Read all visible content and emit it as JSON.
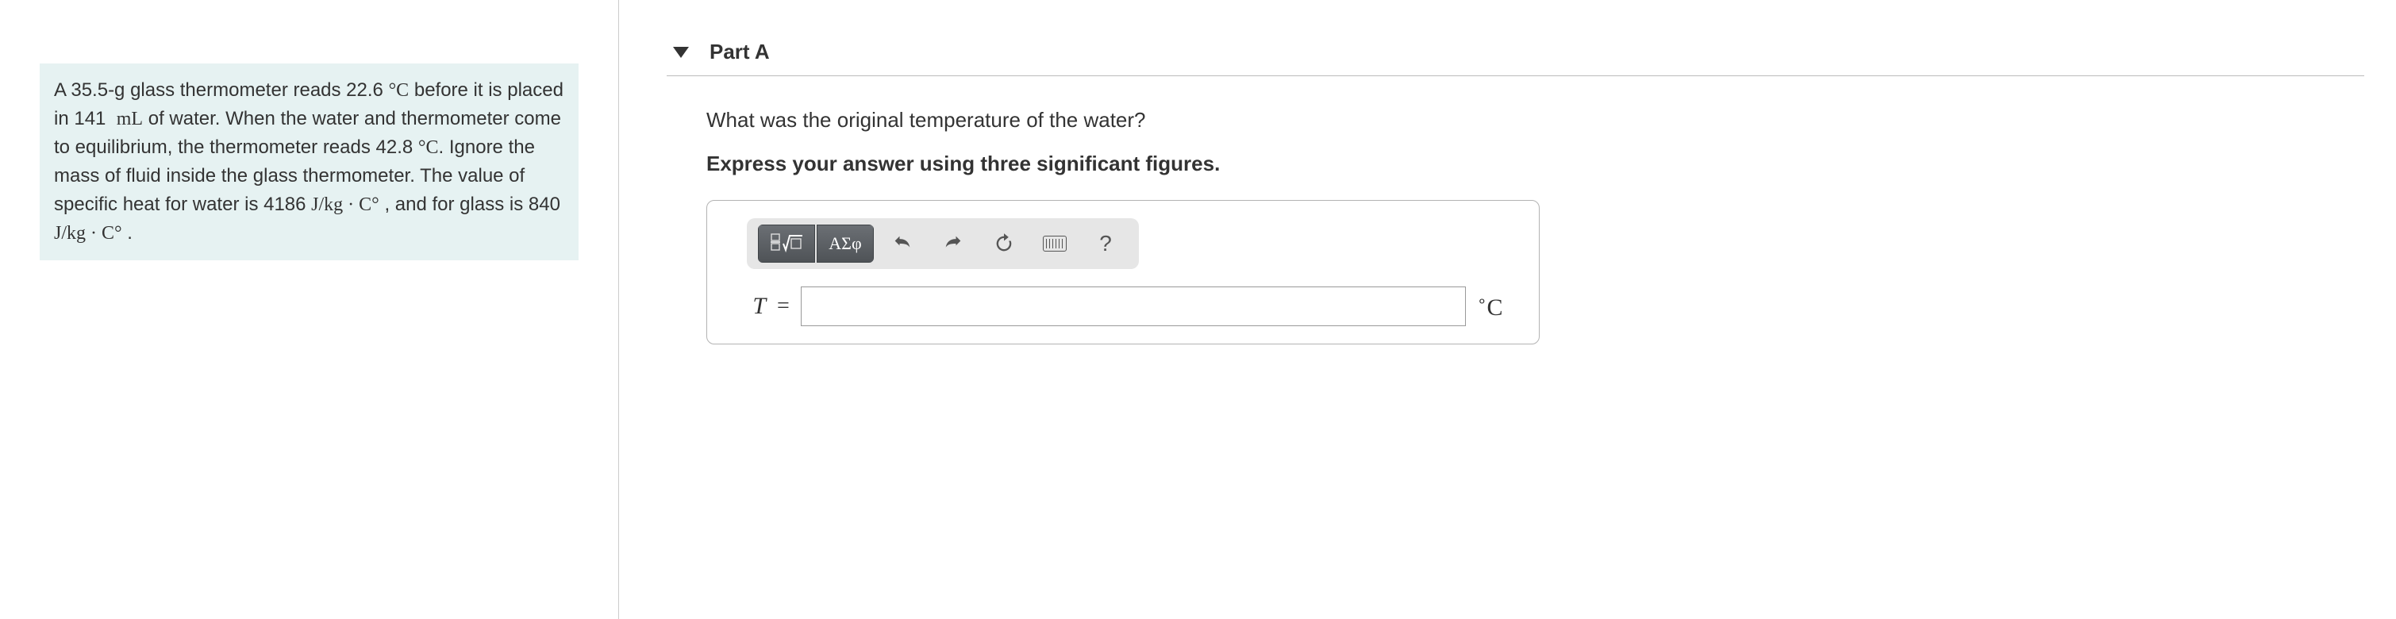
{
  "problem": {
    "text_html": "A 35.5-g glass thermometer reads 22.6 °C before it is placed in 141 mL of water. When the water and thermometer come to equilibrium, the thermometer reads 42.8 °C. Ignore the mass of fluid inside the glass thermometer. The value of specific heat for water is 4186 J/kg · C° , and for glass is 840 J/kg · C° ."
  },
  "part": {
    "label": "Part A",
    "question": "What was the original temperature of the water?",
    "instruction": "Express your answer using three significant figures.",
    "answer": {
      "variable": "T",
      "equals": "=",
      "value": "",
      "unit_prefix": "∘",
      "unit": "C"
    },
    "toolbar": {
      "templates_label": "templates",
      "greek_label": "ΑΣφ",
      "undo": "undo",
      "redo": "redo",
      "reset": "reset",
      "keyboard": "keyboard",
      "help": "?"
    }
  }
}
